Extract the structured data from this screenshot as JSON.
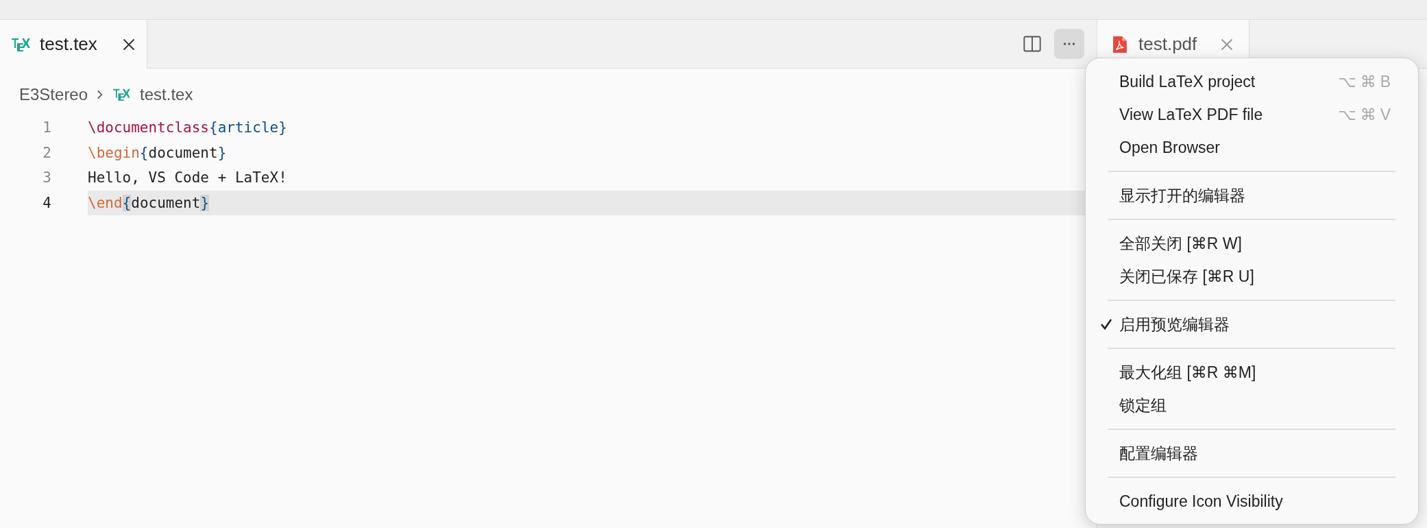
{
  "tabs": [
    {
      "label": "test.tex",
      "selected": true
    }
  ],
  "breadcrumbs": [
    "E3Stereo",
    "test.tex"
  ],
  "code_lines": [
    {
      "number": "1",
      "current": false,
      "tokens": [
        {
          "text": "\\documentclass",
          "kind": "command"
        },
        {
          "text": "{",
          "kind": "brace"
        },
        {
          "text": "article",
          "kind": "argument"
        },
        {
          "text": "}",
          "kind": "brace"
        }
      ]
    },
    {
      "number": "2",
      "current": false,
      "tokens": [
        {
          "text": "\\begin",
          "kind": "keyword"
        },
        {
          "text": "{",
          "kind": "brace"
        },
        {
          "text": "document",
          "kind": "text"
        },
        {
          "text": "}",
          "kind": "brace"
        }
      ]
    },
    {
      "number": "3",
      "current": false,
      "tokens": [
        {
          "text": "Hello, VS Code + LaTeX!",
          "kind": "text"
        }
      ]
    },
    {
      "number": "4",
      "current": true,
      "tokens": [
        {
          "text": "\\end",
          "kind": "keyword"
        },
        {
          "text": "{",
          "kind": "matched-brace"
        },
        {
          "text": "document",
          "kind": "text"
        },
        {
          "text": "}",
          "kind": "matched-brace"
        }
      ]
    }
  ],
  "pdf_tab": {
    "label": "test.pdf",
    "selected": true
  },
  "menu": {
    "items": [
      {
        "kind": "item",
        "label": "Build LaTeX project",
        "shortcut": "⌥⌘B",
        "checked": false
      },
      {
        "kind": "item",
        "label": "View LaTeX PDF file",
        "shortcut": "⌥⌘V",
        "checked": false
      },
      {
        "kind": "item",
        "label": "Open Browser",
        "checked": false
      },
      {
        "kind": "separator"
      },
      {
        "kind": "item",
        "label": "显示打开的编辑器",
        "checked": false
      },
      {
        "kind": "separator"
      },
      {
        "kind": "item",
        "label": "全部关闭 [⌘R W]",
        "checked": false
      },
      {
        "kind": "item",
        "label": "关闭已保存 [⌘R U]",
        "checked": false
      },
      {
        "kind": "separator"
      },
      {
        "kind": "item",
        "label": "启用预览编辑器",
        "checked": true
      },
      {
        "kind": "separator"
      },
      {
        "kind": "item",
        "label": "最大化组 [⌘R ⌘M]",
        "checked": false
      },
      {
        "kind": "item",
        "label": "锁定组",
        "checked": false
      },
      {
        "kind": "separator"
      },
      {
        "kind": "item",
        "label": "配置编辑器",
        "checked": false
      },
      {
        "kind": "separator"
      },
      {
        "kind": "item",
        "label": "Configure Icon Visibility",
        "checked": false
      }
    ]
  }
}
